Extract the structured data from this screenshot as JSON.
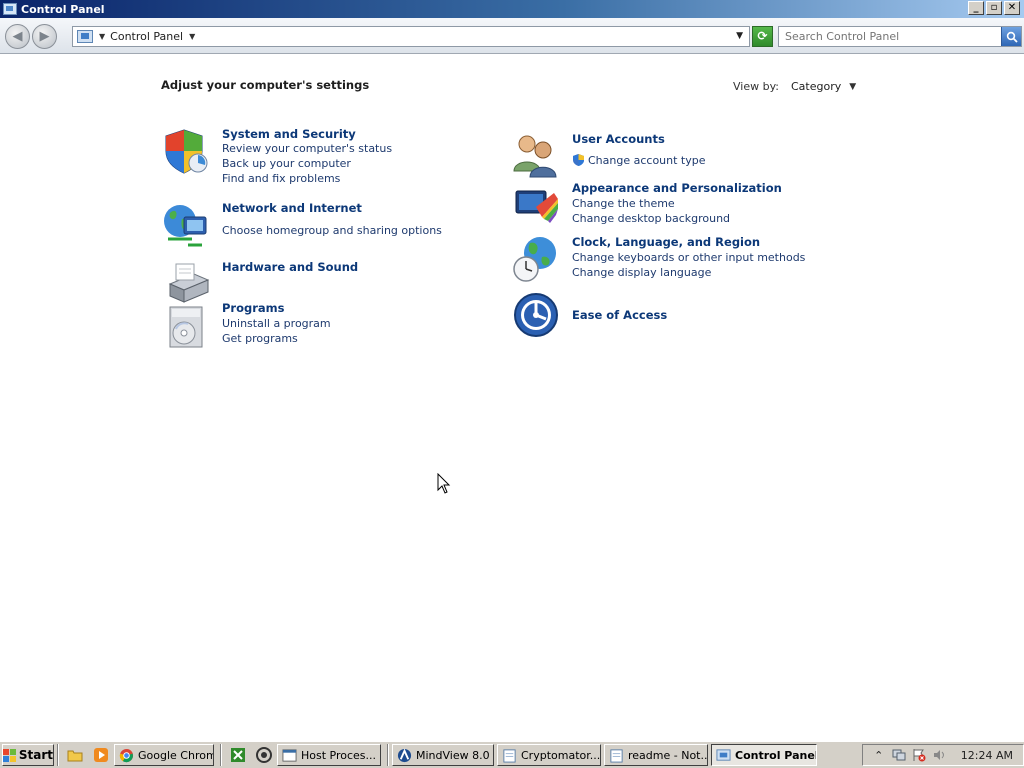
{
  "window": {
    "title": "Control Panel"
  },
  "address_bar": {
    "breadcrumb": "Control Panel",
    "search_placeholder": "Search Control Panel"
  },
  "main": {
    "heading": "Adjust your computer's settings",
    "view_by_label": "View by:",
    "view_by_value": "Category",
    "categories_left": [
      {
        "title": "System and Security",
        "links": [
          "Review your computer's status",
          "Back up your computer",
          "Find and fix problems"
        ]
      },
      {
        "title": "Network and Internet",
        "links": [
          "Choose homegroup and sharing options"
        ]
      },
      {
        "title": "Hardware and Sound",
        "links": []
      },
      {
        "title": "Programs",
        "links": [
          "Uninstall a program",
          "Get programs"
        ]
      }
    ],
    "categories_right": [
      {
        "title": "User Accounts",
        "links": [
          "Change account type"
        ]
      },
      {
        "title": "Appearance and Personalization",
        "links": [
          "Change the theme",
          "Change desktop background"
        ]
      },
      {
        "title": "Clock, Language, and Region",
        "links": [
          "Change keyboards or other input methods",
          "Change display language"
        ]
      },
      {
        "title": "Ease of Access",
        "links": []
      }
    ]
  },
  "taskbar": {
    "start_label": "Start",
    "tasks": [
      "Google Chrome",
      "Host Proces...",
      "MindView 8.0 ...",
      "Cryptomator...",
      "readme - Not...",
      "Control Panel"
    ],
    "clock": "12:24 AM"
  }
}
